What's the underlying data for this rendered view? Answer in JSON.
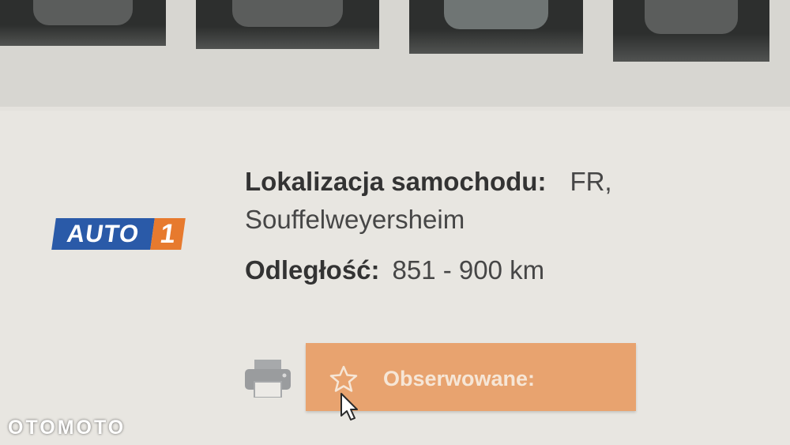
{
  "listing": {
    "location_label": "Lokalizacja samochodu:",
    "location_country": "FR,",
    "location_city": "Souffelweyersheim",
    "distance_label": "Odległość:",
    "distance_value": "851 - 900 km"
  },
  "dealer_logo": {
    "text_main": "AUTO",
    "text_accent": "1"
  },
  "actions": {
    "print_icon": "printer-icon",
    "watch_label": "Obserwowane:",
    "watch_icon": "star-icon"
  },
  "watermark": "OTOMOTO",
  "colors": {
    "watch_button": "#e8a36f",
    "logo_blue": "#2a5aa8",
    "logo_orange": "#e77a2e"
  }
}
